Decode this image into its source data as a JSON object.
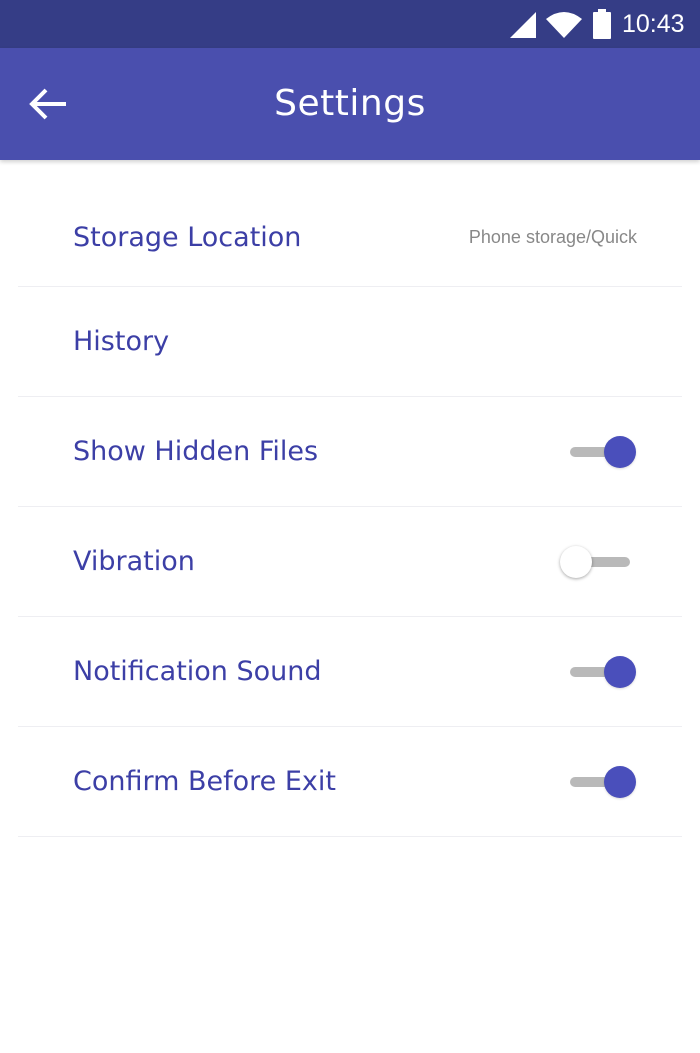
{
  "status_bar": {
    "time": "10:43",
    "icons": [
      "signal-icon",
      "wifi-icon",
      "battery-icon"
    ]
  },
  "app_bar": {
    "back_icon": "back-arrow-icon",
    "title": "Settings"
  },
  "settings": [
    {
      "label": "Storage Location",
      "value": "Phone storage/Quick",
      "control": "value"
    },
    {
      "label": "History",
      "control": "none"
    },
    {
      "label": "Show Hidden Files",
      "control": "toggle",
      "on": true
    },
    {
      "label": "Vibration",
      "control": "toggle",
      "on": false
    },
    {
      "label": "Notification Sound",
      "control": "toggle",
      "on": true
    },
    {
      "label": "Confirm Before Exit",
      "control": "toggle",
      "on": true
    }
  ],
  "colors": {
    "status_bar": "#353d86",
    "app_bar": "#4a4fae",
    "accent": "#4a4fbb",
    "label_text": "#3c3fa6",
    "value_text": "#888888",
    "toggle_track": "#b9b9b9"
  }
}
